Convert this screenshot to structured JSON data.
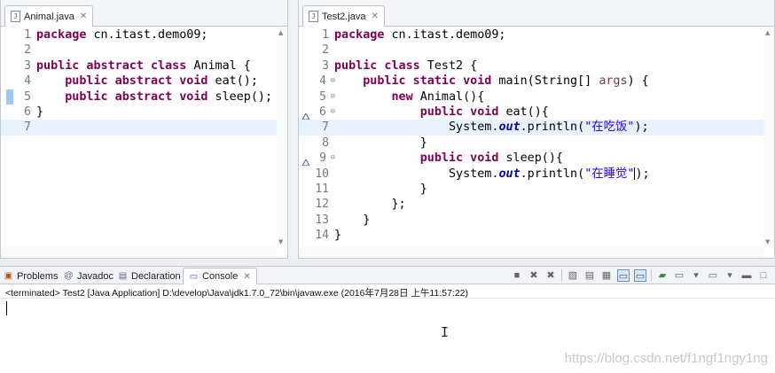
{
  "editor1": {
    "tab_title": "Animal.java",
    "lines": [
      {
        "num": "1",
        "tokens": [
          {
            "t": "kw",
            "v": "package"
          },
          {
            "t": "n",
            "v": " cn.itast.demo09;"
          }
        ]
      },
      {
        "num": "2",
        "tokens": []
      },
      {
        "num": "3",
        "tokens": [
          {
            "t": "kw",
            "v": "public abstract class"
          },
          {
            "t": "n",
            "v": " Animal {"
          }
        ]
      },
      {
        "num": "4",
        "tokens": [
          {
            "t": "n",
            "v": "    "
          },
          {
            "t": "kw",
            "v": "public abstract void"
          },
          {
            "t": "n",
            "v": " eat();"
          }
        ]
      },
      {
        "num": "5",
        "tokens": [
          {
            "t": "n",
            "v": "    "
          },
          {
            "t": "kw",
            "v": "public abstract void"
          },
          {
            "t": "n",
            "v": " sleep();"
          }
        ]
      },
      {
        "num": "6",
        "tokens": [
          {
            "t": "n",
            "v": "}"
          }
        ]
      },
      {
        "num": "7",
        "tokens": []
      }
    ],
    "highlight_line": 7,
    "marker_line": 5
  },
  "editor2": {
    "tab_title": "Test2.java",
    "lines": [
      {
        "num": "1",
        "tokens": [
          {
            "t": "kw",
            "v": "package"
          },
          {
            "t": "n",
            "v": " cn.itast.demo09;"
          }
        ]
      },
      {
        "num": "2",
        "tokens": []
      },
      {
        "num": "3",
        "tokens": [
          {
            "t": "kw",
            "v": "public class"
          },
          {
            "t": "n",
            "v": " Test2 {"
          }
        ]
      },
      {
        "num": "4",
        "fold": true,
        "tokens": [
          {
            "t": "n",
            "v": "    "
          },
          {
            "t": "kw",
            "v": "public static void"
          },
          {
            "t": "n",
            "v": " main(String[] "
          },
          {
            "t": "par",
            "v": "args"
          },
          {
            "t": "n",
            "v": ") {"
          }
        ]
      },
      {
        "num": "5",
        "fold": true,
        "tokens": [
          {
            "t": "n",
            "v": "        "
          },
          {
            "t": "kw",
            "v": "new"
          },
          {
            "t": "n",
            "v": " Animal(){"
          }
        ]
      },
      {
        "num": "6",
        "fold": true,
        "override": true,
        "tokens": [
          {
            "t": "n",
            "v": "            "
          },
          {
            "t": "kw",
            "v": "public void"
          },
          {
            "t": "n",
            "v": " eat(){"
          }
        ]
      },
      {
        "num": "7",
        "tokens": [
          {
            "t": "n",
            "v": "                System."
          },
          {
            "t": "fld",
            "v": "out"
          },
          {
            "t": "n",
            "v": ".println("
          },
          {
            "t": "str",
            "v": "\"在吃饭\""
          },
          {
            "t": "n",
            "v": ");"
          }
        ]
      },
      {
        "num": "8",
        "tokens": [
          {
            "t": "n",
            "v": "            }"
          }
        ]
      },
      {
        "num": "9",
        "fold": true,
        "override": true,
        "tokens": [
          {
            "t": "n",
            "v": "            "
          },
          {
            "t": "kw",
            "v": "public void"
          },
          {
            "t": "n",
            "v": " sleep(){"
          }
        ]
      },
      {
        "num": "10",
        "tokens": [
          {
            "t": "n",
            "v": "                System."
          },
          {
            "t": "fld",
            "v": "out"
          },
          {
            "t": "n",
            "v": ".println("
          },
          {
            "t": "str",
            "v": "\"在睡觉\""
          },
          {
            "t": "caret",
            "v": ""
          },
          {
            "t": "n",
            "v": ");"
          }
        ]
      },
      {
        "num": "11",
        "tokens": [
          {
            "t": "n",
            "v": "            }"
          }
        ]
      },
      {
        "num": "12",
        "tokens": [
          {
            "t": "n",
            "v": "        };"
          }
        ]
      },
      {
        "num": "13",
        "tokens": [
          {
            "t": "n",
            "v": "    }"
          }
        ]
      },
      {
        "num": "14",
        "tokens": [
          {
            "t": "n",
            "v": "}"
          }
        ]
      }
    ],
    "highlight_line": 7
  },
  "console": {
    "tabs": [
      {
        "label": "Problems",
        "icon": "problems-icon"
      },
      {
        "label": "Javadoc",
        "icon": "javadoc-icon"
      },
      {
        "label": "Declaration",
        "icon": "declaration-icon"
      },
      {
        "label": "Console",
        "icon": "console-icon",
        "active": true
      }
    ],
    "status": "<terminated> Test2 [Java Application] D:\\develop\\Java\\jdk1.7.0_72\\bin\\javaw.exe (2016年7月28日 上午11:57:22)"
  },
  "watermark": "https://blog.csdn.net/f1ngf1ngy1ng"
}
